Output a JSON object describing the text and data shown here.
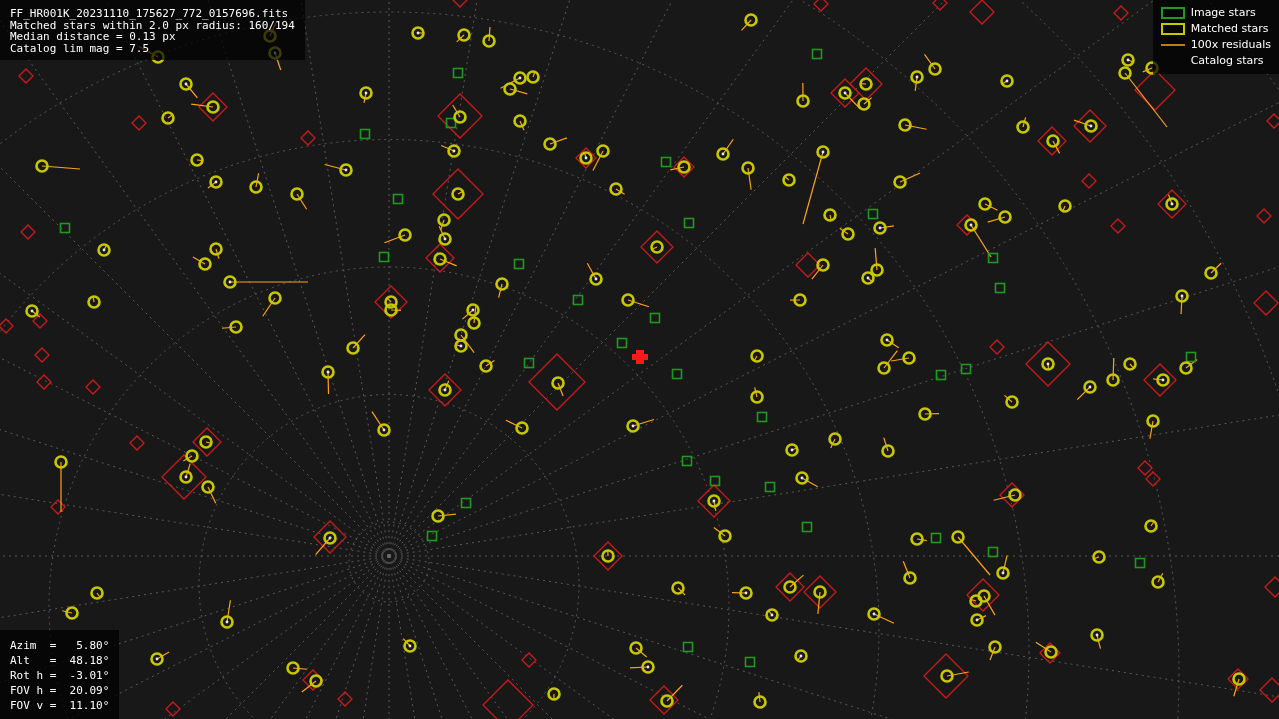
{
  "info_lines": [
    "FF_HR001K_20231110_175627_772_0157696.fits",
    "Matched stars within 2.0 px radius: 160/194",
    "Median distance = 0.13 px",
    "Catalog lim mag = 7.5"
  ],
  "legend": [
    {
      "kind": "image",
      "label": "Image stars"
    },
    {
      "kind": "matched",
      "label": "Matched stars"
    },
    {
      "kind": "residual",
      "label": "100x residuals"
    },
    {
      "kind": "catalog",
      "label": "Catalog stars"
    }
  ],
  "pointing": [
    "Azim  =   5.80°",
    "Alt   =  48.18°",
    "Rot h =  -3.01°",
    "FOV h =  20.09°",
    "FOV v =  11.10°"
  ]
}
